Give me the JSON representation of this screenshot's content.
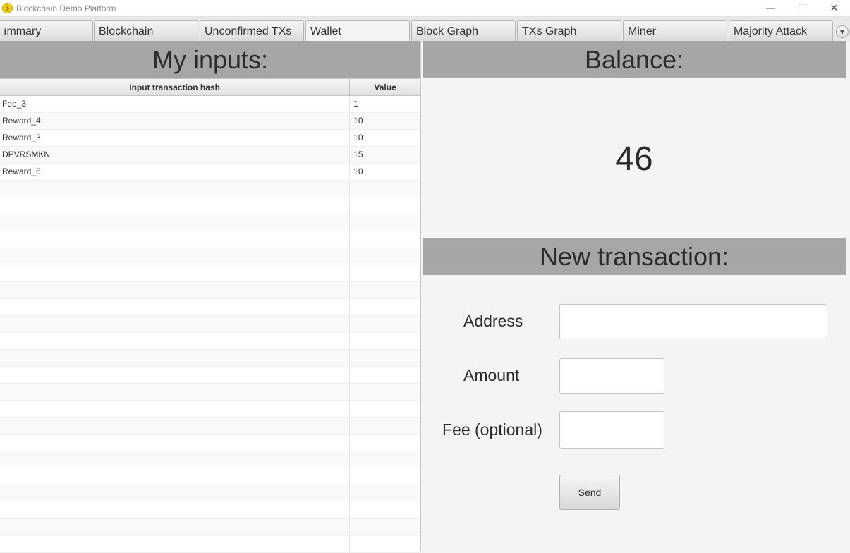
{
  "window": {
    "title": "Blockchain Demo Platform",
    "icon": "coin-icon",
    "minimize_glyph": "—",
    "maximize_glyph": "☐",
    "close_glyph": "✕"
  },
  "tabs": [
    {
      "label": "ımmary",
      "selected": false
    },
    {
      "label": "Blockchain",
      "selected": false
    },
    {
      "label": "Unconfirmed TXs",
      "selected": false
    },
    {
      "label": "Wallet",
      "selected": true
    },
    {
      "label": "Block Graph",
      "selected": false
    },
    {
      "label": "TXs Graph",
      "selected": false
    },
    {
      "label": "Miner",
      "selected": false
    },
    {
      "label": "Majority Attack",
      "selected": false
    }
  ],
  "tab_scroll_glyph": "▼",
  "inputs_panel": {
    "title": "My inputs:",
    "columns": [
      "Input transaction hash",
      "Value"
    ],
    "rows": [
      {
        "hash": "Fee_3",
        "value": "1"
      },
      {
        "hash": "Reward_4",
        "value": "10"
      },
      {
        "hash": "Reward_3",
        "value": "10"
      },
      {
        "hash": "DPVRSMKN",
        "value": "15"
      },
      {
        "hash": "Reward_6",
        "value": "10"
      }
    ]
  },
  "balance_panel": {
    "title": "Balance:",
    "value": "46"
  },
  "new_transaction": {
    "title": "New transaction:",
    "address_label": "Address",
    "amount_label": "Amount",
    "fee_label": "Fee (optional)",
    "address_value": "",
    "amount_value": "",
    "fee_value": "",
    "send_label": "Send"
  }
}
